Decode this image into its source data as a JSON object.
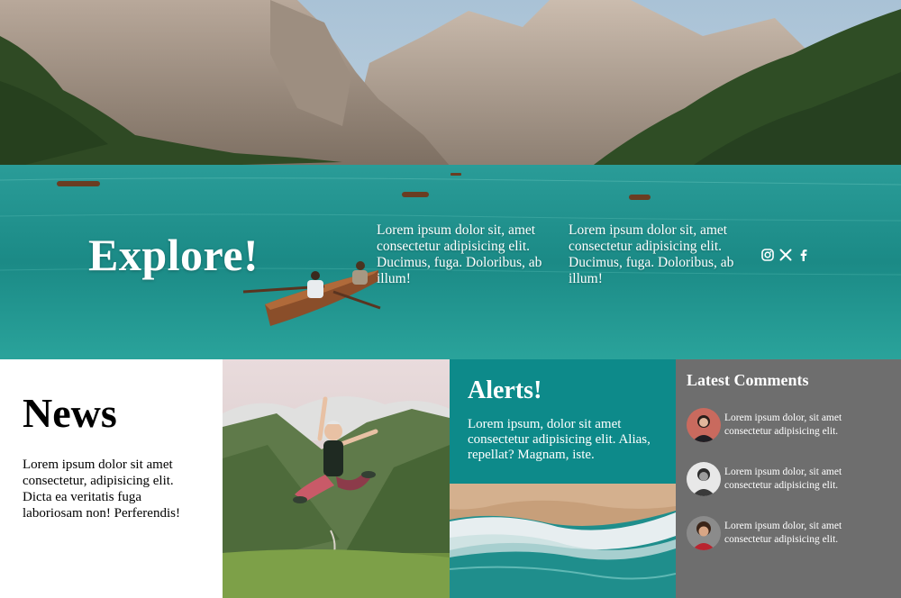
{
  "hero": {
    "title": "Explore!",
    "text_col1": "Lorem ipsum dolor sit, amet consectetur adipisicing elit. Ducimus, fuga. Doloribus, ab illum!",
    "text_col2": "Lorem ipsum dolor sit, amet consectetur adipisicing elit. Ducimus, fuga. Doloribus, ab illum!",
    "socials": [
      {
        "icon": "instagram-icon"
      },
      {
        "icon": "x-twitter-icon"
      },
      {
        "icon": "facebook-icon"
      }
    ]
  },
  "news": {
    "title": "News",
    "text": "Lorem ipsum dolor sit amet consectetur, adipisicing elit. Dicta ea veritatis fuga laboriosam non! Perferendis!"
  },
  "alerts": {
    "title": "Alerts!",
    "text": "Lorem ipsum, dolor sit amet consectetur adipisicing elit. Alias, repellat? Magnam, iste."
  },
  "comments": {
    "title": "Latest Comments",
    "items": [
      {
        "text": "Lorem ipsum dolor, sit amet consectetur adipisicing elit."
      },
      {
        "text": "Lorem ipsum dolor, sit amet consectetur adipisicing elit."
      },
      {
        "text": "Lorem ipsum dolor, sit amet consectetur adipisicing elit."
      }
    ]
  },
  "colors": {
    "alerts_bg": "#0d8a8a",
    "comments_bg": "#6e6e6e",
    "hero_water": "#1c8d8a"
  }
}
